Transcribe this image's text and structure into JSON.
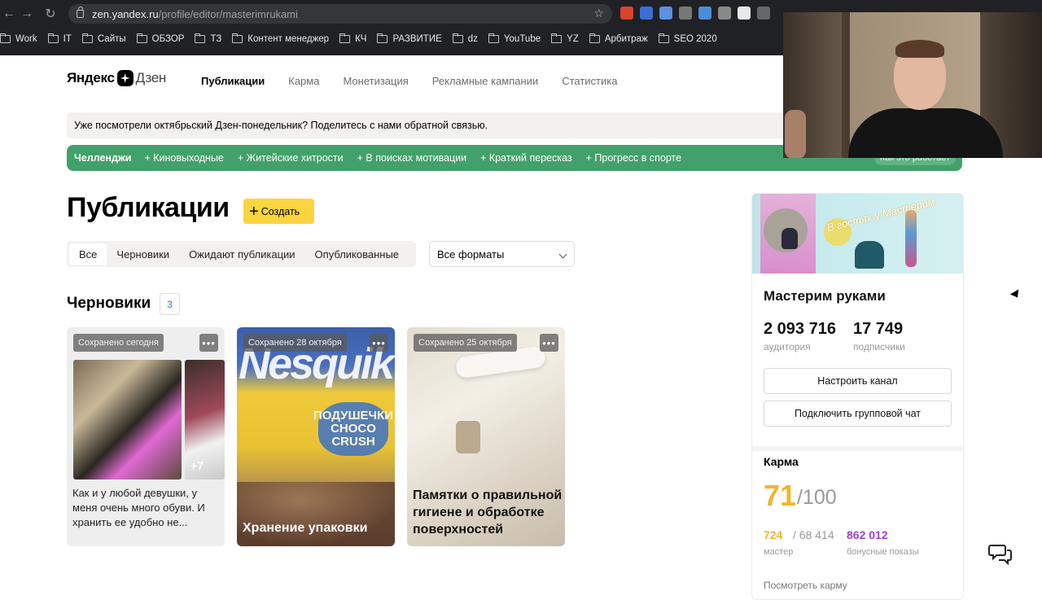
{
  "browser": {
    "url_host": "zen.yandex.ru",
    "url_path": "/profile/editor/masterimrukami",
    "bookmarks": [
      "Work",
      "IT",
      "Сайты",
      "ОБЗОР",
      "ТЗ",
      "Контент менеджер",
      "КЧ",
      "РАЗВИТИЕ",
      "dz",
      "YouTube",
      "YZ",
      "Арбитраж",
      "SEO 2020"
    ]
  },
  "header": {
    "logo_yandex": "Яндекс",
    "logo_dzen": "Дзен",
    "nav": [
      "Публикации",
      "Карма",
      "Монетизация",
      "Рекламные кампании",
      "Статистика"
    ],
    "active_nav": "Публикации"
  },
  "notice": "Уже посмотрели октябрьский Дзен-понедельник? Поделитесь с нами обратной связью.",
  "challenges": {
    "title": "Челленджи",
    "items": [
      "+ Киновыходные",
      "+ Житейские хитрости",
      "+ В поисках мотивации",
      "+ Краткий пересказ",
      "+ Прогресс в спорте"
    ],
    "button": "Как это работает"
  },
  "main": {
    "title": "Публикации",
    "create_label": "Создать",
    "filters": [
      "Все",
      "Черновики",
      "Ожидают публикации",
      "Опубликованные"
    ],
    "format_select": "Все форматы",
    "drafts_title": "Черновики",
    "drafts_count": "3",
    "cards": [
      {
        "badge": "Сохранено сегодня",
        "caption": "Как и у любой девушки, у меня очень много обуви. И хранить ее удобно не...",
        "extra": "+7"
      },
      {
        "badge": "Сохранено 28 октября",
        "caption": "Хранение упаковки",
        "brand": "Nesquik",
        "pack": "ПОДУШЕЧКИ CHOCO CRUSH"
      },
      {
        "badge": "Сохранено 25 октября",
        "caption": "Памятки о правильной гигиене и обработке поверхностей"
      }
    ],
    "more_label": "•••"
  },
  "sidebar": {
    "banner_text": "В гостях у Мастерим",
    "channel_name": "Мастерим руками",
    "audience_value": "2 093 716",
    "audience_label": "аудитория",
    "subscribers_value": "17 749",
    "subscribers_label": "подписчики",
    "setup_button": "Настроить канал",
    "group_chat_button": "Подключить групповой чат",
    "karma_title": "Карма",
    "karma_score": "71",
    "karma_max": "/100",
    "master_value": "724",
    "master_total": "/ 68 414",
    "master_label": "мастер",
    "bonus_value": "862 012",
    "bonus_label": "бонусные показы",
    "karma_link": "Посмотреть карму"
  }
}
